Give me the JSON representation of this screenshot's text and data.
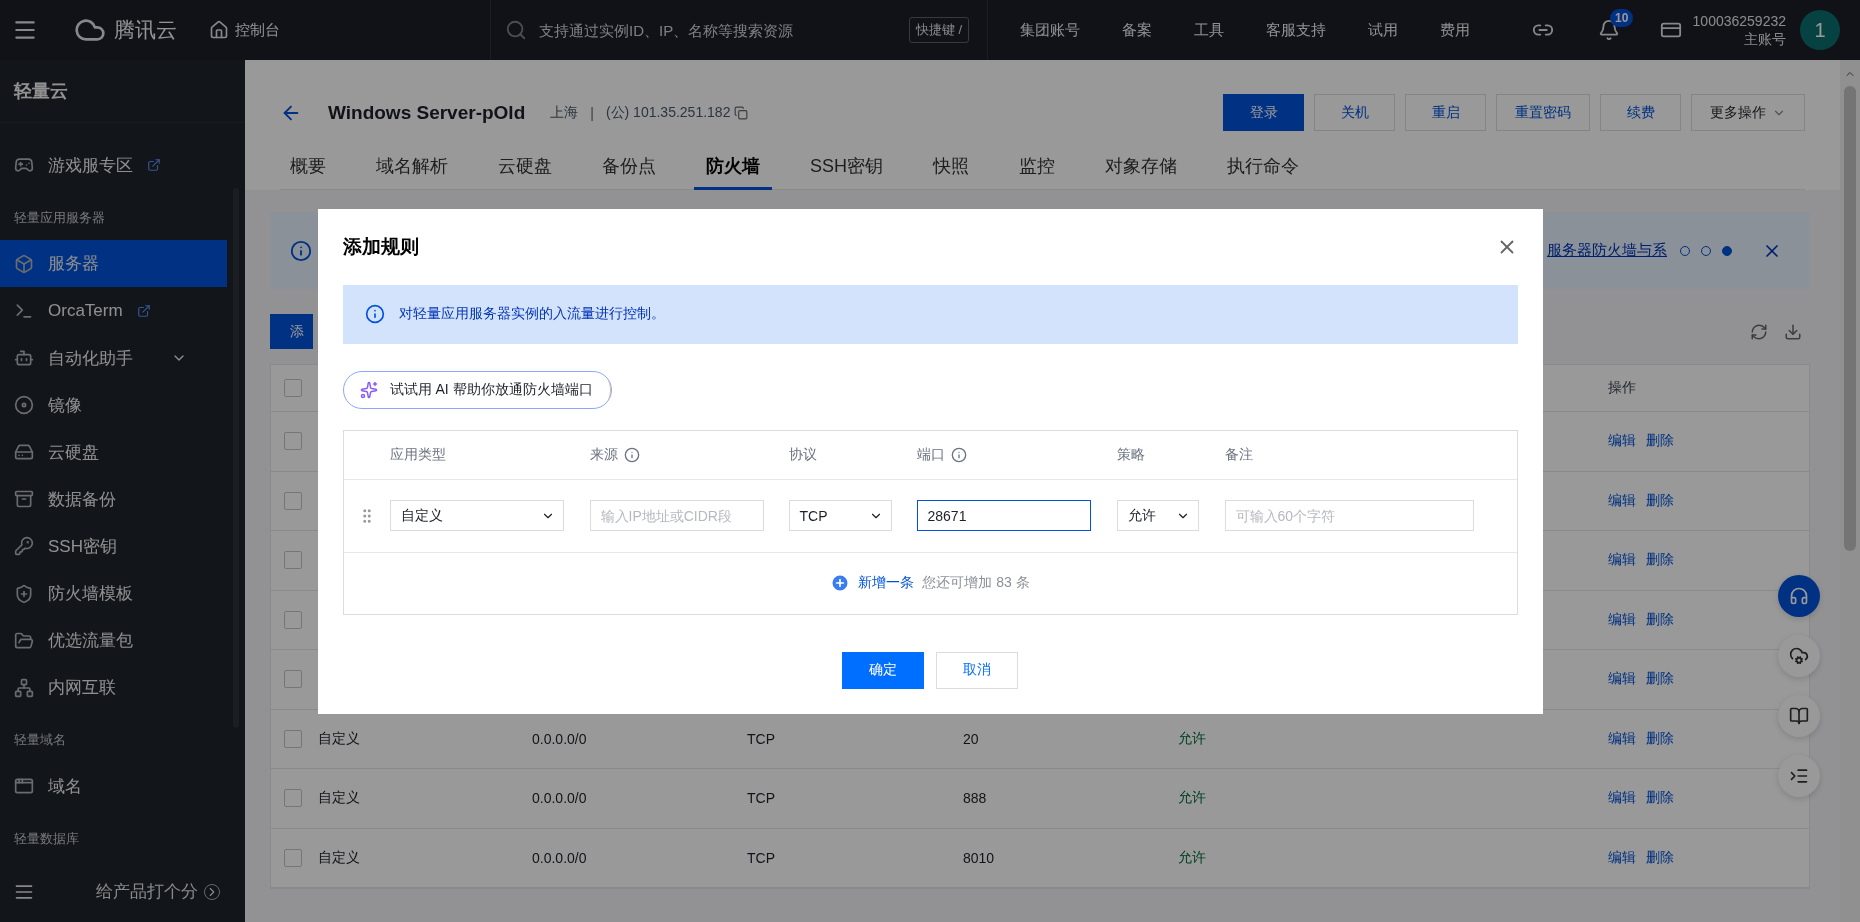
{
  "topbar": {
    "brand": "腾讯云",
    "console": "控制台",
    "search": {
      "placeholder": "支持通过实例ID、IP、名称等搜索资源",
      "shortcut": "快捷键 /"
    },
    "nav": [
      "集团账号",
      "备案",
      "工具",
      "客服支持",
      "试用",
      "费用"
    ],
    "notifications": "10",
    "account": {
      "id": "100036259232",
      "role": "主账号",
      "avatar": "1"
    }
  },
  "sidebar": {
    "title": "轻量云",
    "items": [
      {
        "kind": "item",
        "label": "游戏服专区",
        "external": true,
        "selected": false
      },
      {
        "kind": "section",
        "label": "轻量应用服务器"
      },
      {
        "kind": "item",
        "label": "服务器",
        "external": false,
        "selected": true
      },
      {
        "kind": "item",
        "label": "OrcaTerm",
        "external": true,
        "selected": false
      },
      {
        "kind": "group",
        "label": "自动化助手",
        "expanded": false,
        "selected": false
      },
      {
        "kind": "item",
        "label": "镜像",
        "external": false,
        "selected": false
      },
      {
        "kind": "item",
        "label": "云硬盘",
        "external": false,
        "selected": false
      },
      {
        "kind": "item",
        "label": "数据备份",
        "external": false,
        "selected": false
      },
      {
        "kind": "item",
        "label": "SSH密钥",
        "external": false,
        "selected": false
      },
      {
        "kind": "item",
        "label": "防火墙模板",
        "external": false,
        "selected": false
      },
      {
        "kind": "item",
        "label": "优选流量包",
        "external": false,
        "selected": false
      },
      {
        "kind": "item",
        "label": "内网互联",
        "external": false,
        "selected": false
      },
      {
        "kind": "section",
        "label": "轻量域名"
      },
      {
        "kind": "item",
        "label": "域名",
        "external": false,
        "selected": false
      },
      {
        "kind": "section",
        "label": "轻量数据库"
      }
    ],
    "footer": "给产品打个分"
  },
  "header": {
    "title": "Windows Server-pOld",
    "region": "上海",
    "separator": "|",
    "ip": "(公) 101.35.251.182",
    "actions": [
      {
        "label": "登录",
        "kind": "primary"
      },
      {
        "label": "关机",
        "kind": "default"
      },
      {
        "label": "重启",
        "kind": "default"
      },
      {
        "label": "重置密码",
        "kind": "default"
      },
      {
        "label": "续费",
        "kind": "default"
      },
      {
        "label": "更多操作",
        "kind": "dropdown"
      }
    ]
  },
  "tabs": [
    {
      "label": "概要",
      "selected": false
    },
    {
      "label": "域名解析",
      "selected": false
    },
    {
      "label": "云硬盘",
      "selected": false
    },
    {
      "label": "备份点",
      "selected": false
    },
    {
      "label": "防火墙",
      "selected": true
    },
    {
      "label": "SSH密钥",
      "selected": false
    },
    {
      "label": "快照",
      "selected": false
    },
    {
      "label": "监控",
      "selected": false
    },
    {
      "label": "对象存储",
      "selected": false
    },
    {
      "label": "执行命令",
      "selected": false
    }
  ],
  "notice": {
    "link": "服务器防火墙与系",
    "pages": [
      {
        "selected": false
      },
      {
        "selected": false
      },
      {
        "selected": true
      }
    ]
  },
  "toolbar": {
    "add_button": "添"
  },
  "table": {
    "header_checked": false,
    "columns": [
      {
        "label": "操作"
      }
    ],
    "rows": [
      {
        "checked": false,
        "actions": [
          "编辑",
          "删除"
        ]
      },
      {
        "checked": false,
        "actions": [
          "编辑",
          "删除"
        ]
      },
      {
        "checked": false,
        "actions": [
          "编辑",
          "删除"
        ]
      },
      {
        "checked": false,
        "actions": [
          "编辑",
          "删除"
        ]
      },
      {
        "checked": false,
        "actions": [
          "编辑",
          "删除"
        ]
      },
      {
        "checked": false,
        "cells": [
          "自定义",
          "0.0.0.0/0",
          "TCP",
          "20",
          "允许"
        ],
        "actions": [
          "编辑",
          "删除"
        ]
      },
      {
        "checked": false,
        "cells": [
          "自定义",
          "0.0.0.0/0",
          "TCP",
          "888",
          "允许"
        ],
        "actions": [
          "编辑",
          "删除"
        ]
      },
      {
        "checked": false,
        "cells": [
          "自定义",
          "0.0.0.0/0",
          "TCP",
          "8010",
          "允许"
        ],
        "actions": [
          "编辑",
          "删除"
        ]
      }
    ]
  },
  "modal": {
    "title": "添加规则",
    "notice": "对轻量应用服务器实例的入流量进行控制。",
    "ai_button": "试试用 AI 帮助你放通防火墙端口",
    "columns": [
      {
        "label": "应用类型",
        "info": false
      },
      {
        "label": "来源",
        "info": true
      },
      {
        "label": "协议",
        "info": false
      },
      {
        "label": "端口",
        "info": true
      },
      {
        "label": "策略",
        "info": false
      },
      {
        "label": "备注",
        "info": false
      }
    ],
    "rules": [
      {
        "type": "自定义",
        "source_placeholder": "输入IP地址或CIDR段",
        "protocol": "TCP",
        "port": "28671",
        "port_focused": true,
        "policy": "允许",
        "note_placeholder": "可输入60个字符"
      }
    ],
    "add": {
      "label": "新增一条",
      "hint": "您还可增加 83 条"
    },
    "buttons": [
      {
        "label": "确定",
        "kind": "primary"
      },
      {
        "label": "取消",
        "kind": "default"
      }
    ]
  }
}
